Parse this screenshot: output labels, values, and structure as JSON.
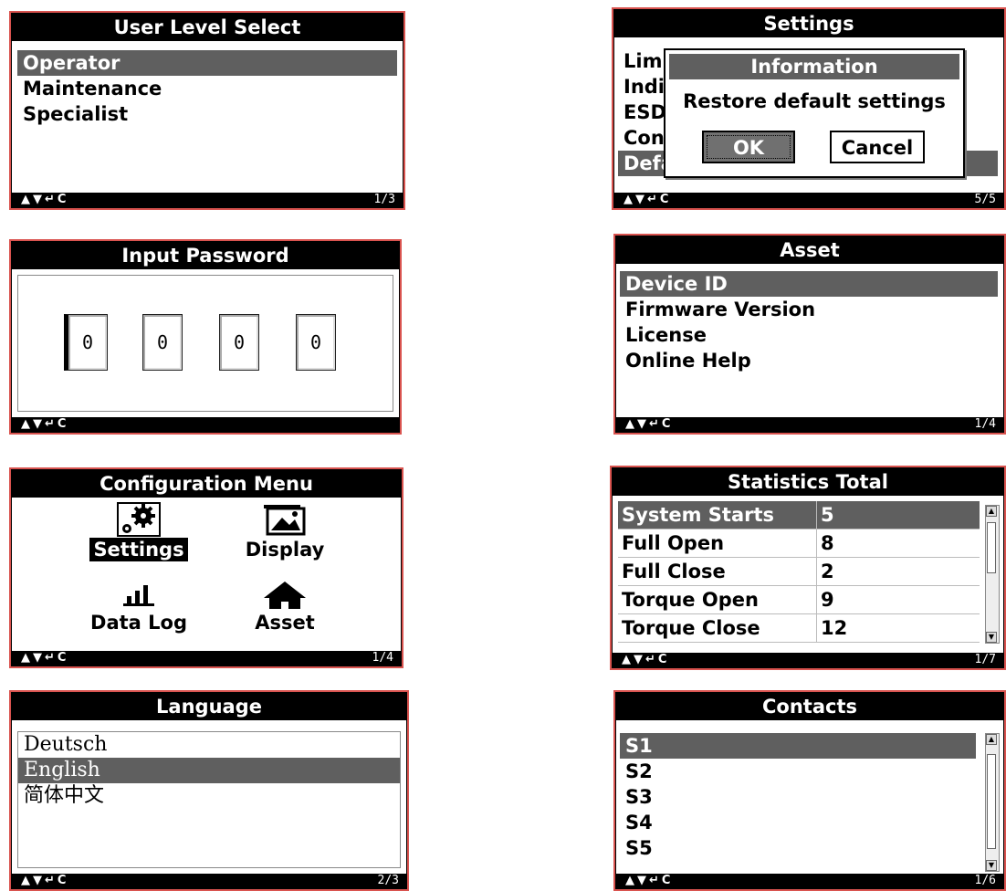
{
  "footer_keys": "▲▼↵C",
  "user_level": {
    "title": "User Level Select",
    "items": [
      "Operator",
      "Maintenance",
      "Specialist"
    ],
    "page": "1/3"
  },
  "password": {
    "title": "Input Password",
    "digits": [
      "0",
      "0",
      "0",
      "0"
    ]
  },
  "config": {
    "title": "Configuration Menu",
    "items": [
      {
        "label": "Settings",
        "icon": "gear-icon"
      },
      {
        "label": "Display",
        "icon": "image-icon"
      },
      {
        "label": "Data Log",
        "icon": "bar-chart-icon"
      },
      {
        "label": "Asset",
        "icon": "house-icon"
      }
    ],
    "page": "1/4"
  },
  "language": {
    "title": "Language",
    "items": [
      "Deutsch",
      "English",
      "简体中文"
    ],
    "page": "2/3"
  },
  "settings": {
    "title": "Settings",
    "items": [
      "Limi",
      "Indi",
      "ESD",
      "Con",
      "Defa"
    ],
    "page": "5/5",
    "dialog": {
      "title": "Information",
      "message": "Restore default settings",
      "ok": "OK",
      "cancel": "Cancel"
    }
  },
  "asset": {
    "title": "Asset",
    "items": [
      "Device ID",
      "Firmware Version",
      "License",
      "Online Help"
    ],
    "page": "1/4"
  },
  "stats": {
    "title": "Statistics Total",
    "rows": [
      {
        "name": "System Starts",
        "value": "5"
      },
      {
        "name": "Full Open",
        "value": "8"
      },
      {
        "name": "Full Close",
        "value": "2"
      },
      {
        "name": "Torque Open",
        "value": "9"
      },
      {
        "name": "Torque Close",
        "value": "12"
      }
    ],
    "page": "1/7"
  },
  "contacts": {
    "title": "Contacts",
    "items": [
      "S1",
      "S2",
      "S3",
      "S4",
      "S5"
    ],
    "page": "1/6"
  },
  "colors": {
    "frame": "#d9534f",
    "selection": "#5f5f5f",
    "bar": "#000000"
  }
}
